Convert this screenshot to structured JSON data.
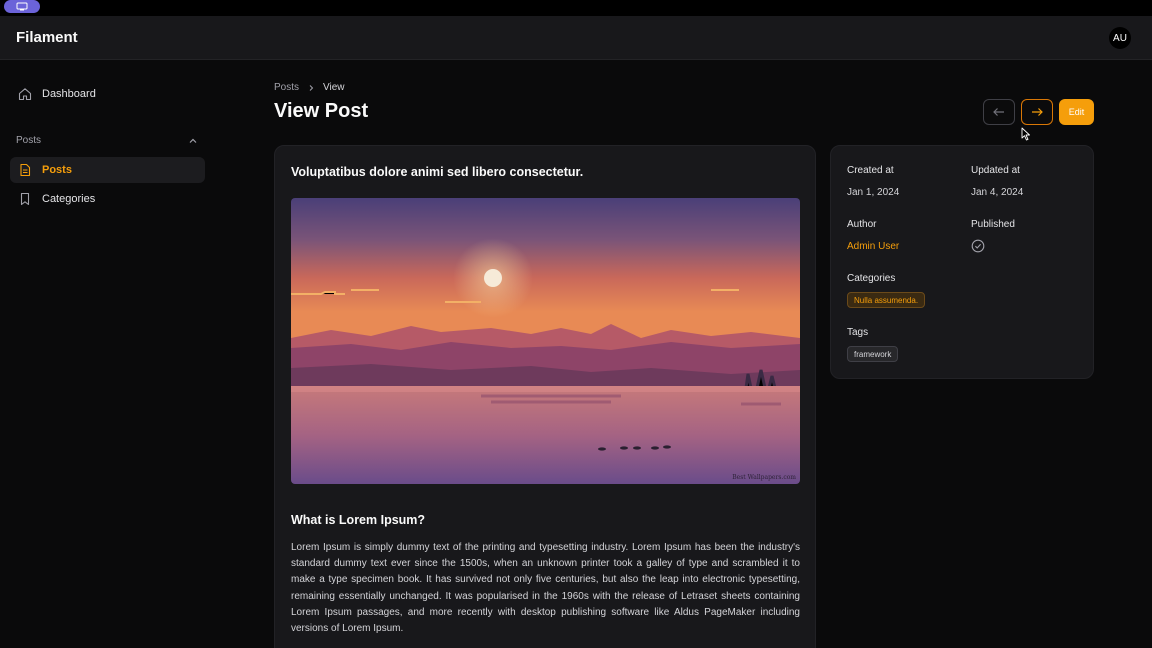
{
  "app": {
    "brand": "Filament",
    "user_initials": "AU"
  },
  "sidebar": {
    "dashboard_label": "Dashboard",
    "group_label": "Posts",
    "items": [
      {
        "label": "Posts",
        "active": true
      },
      {
        "label": "Categories",
        "active": false
      }
    ]
  },
  "breadcrumb": {
    "parent": "Posts",
    "current": "View"
  },
  "page": {
    "title": "View Post",
    "edit_label": "Edit"
  },
  "post": {
    "title": "Voluptatibus dolore animi sed libero consectetur.",
    "section_heading": "What is Lorem Ipsum?",
    "body": "Lorem Ipsum is simply dummy text of the printing and typesetting industry. Lorem Ipsum has been the industry's standard dummy text ever since the 1500s, when an unknown printer took a galley of type and scrambled it to make a type specimen book. It has survived not only five centuries, but also the leap into electronic typesetting, remaining essentially unchanged. It was popularised in the 1960s with the release of Letraset sheets containing Lorem Ipsum passages, and more recently with desktop publishing software like Aldus PageMaker including versions of Lorem Ipsum.",
    "image_watermark": "Best Wallpapers.com"
  },
  "meta": {
    "created_label": "Created at",
    "created_value": "Jan 1, 2024",
    "updated_label": "Updated at",
    "updated_value": "Jan 4, 2024",
    "author_label": "Author",
    "author_value": "Admin User",
    "published_label": "Published",
    "published": true,
    "categories_label": "Categories",
    "category": "Nulla assumenda.",
    "tags_label": "Tags",
    "tag": "framework"
  },
  "colors": {
    "accent": "#f59e0b",
    "background": "#0a0a0b",
    "card": "#18181b"
  }
}
